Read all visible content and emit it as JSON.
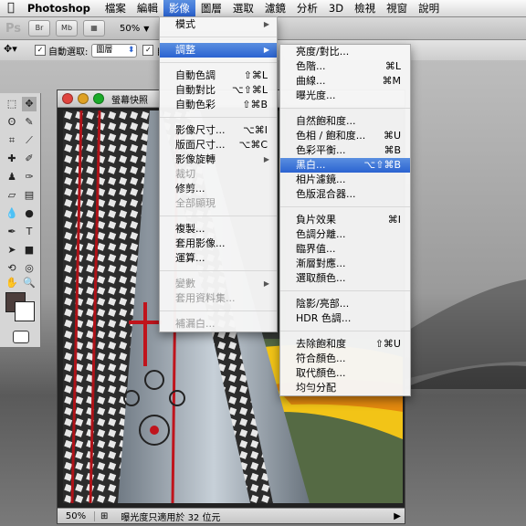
{
  "menubar": {
    "app": "Photoshop",
    "items": [
      "檔案",
      "編輯",
      "影像",
      "圖層",
      "選取",
      "濾鏡",
      "分析",
      "3D",
      "檢視",
      "視窗",
      "說明"
    ],
    "active": "影像"
  },
  "appbar": {
    "ps": "Ps",
    "br": "Br",
    "mb": "Mb",
    "zoom": "50%"
  },
  "optbar": {
    "autoselect_label": "自動選取:",
    "autoselect_value": "圖層",
    "auto_label": "自"
  },
  "document": {
    "title": "螢幕快照",
    "zoom": "50%",
    "status": "曝光度只適用於 32 位元"
  },
  "image_menu": [
    {
      "label": "模式",
      "submenu": true
    },
    {
      "sep": true
    },
    {
      "label": "調整",
      "submenu": true,
      "highlight": true
    },
    {
      "sep": true
    },
    {
      "label": "自動色調",
      "shortcut": "⇧⌘L"
    },
    {
      "label": "自動對比",
      "shortcut": "⌥⇧⌘L"
    },
    {
      "label": "自動色彩",
      "shortcut": "⇧⌘B"
    },
    {
      "sep": true
    },
    {
      "label": "影像尺寸...",
      "shortcut": "⌥⌘I"
    },
    {
      "label": "版面尺寸...",
      "shortcut": "⌥⌘C"
    },
    {
      "label": "影像旋轉",
      "submenu": true
    },
    {
      "label": "裁切",
      "disabled": true
    },
    {
      "label": "修剪..."
    },
    {
      "label": "全部顯現",
      "disabled": true
    },
    {
      "sep": true
    },
    {
      "label": "複製..."
    },
    {
      "label": "套用影像..."
    },
    {
      "label": "運算..."
    },
    {
      "sep": true
    },
    {
      "label": "變數",
      "submenu": true,
      "disabled": true
    },
    {
      "label": "套用資料集...",
      "disabled": true
    },
    {
      "sep": true
    },
    {
      "label": "補漏白...",
      "disabled": true
    }
  ],
  "adjust_menu": [
    {
      "label": "亮度/對比..."
    },
    {
      "label": "色階...",
      "shortcut": "⌘L"
    },
    {
      "label": "曲線...",
      "shortcut": "⌘M"
    },
    {
      "label": "曝光度..."
    },
    {
      "sep": true
    },
    {
      "label": "自然飽和度..."
    },
    {
      "label": "色相 / 飽和度...",
      "shortcut": "⌘U"
    },
    {
      "label": "色彩平衡...",
      "shortcut": "⌘B"
    },
    {
      "label": "黑白...",
      "shortcut": "⌥⇧⌘B",
      "highlight": true
    },
    {
      "label": "相片濾鏡..."
    },
    {
      "label": "色版混合器..."
    },
    {
      "sep": true
    },
    {
      "label": "負片效果",
      "shortcut": "⌘I"
    },
    {
      "label": "色調分離..."
    },
    {
      "label": "臨界值..."
    },
    {
      "label": "漸層對應..."
    },
    {
      "label": "選取顏色..."
    },
    {
      "sep": true
    },
    {
      "label": "陰影/亮部..."
    },
    {
      "label": "HDR 色調..."
    },
    {
      "sep": true
    },
    {
      "label": "去除飽和度",
      "shortcut": "⇧⌘U"
    },
    {
      "label": "符合顏色..."
    },
    {
      "label": "取代顏色..."
    },
    {
      "label": "均勻分配"
    }
  ],
  "colors": {
    "highlight": "#2b63d1",
    "foreground_swatch": "#4c3e3c",
    "background_swatch": "#ffffff"
  }
}
